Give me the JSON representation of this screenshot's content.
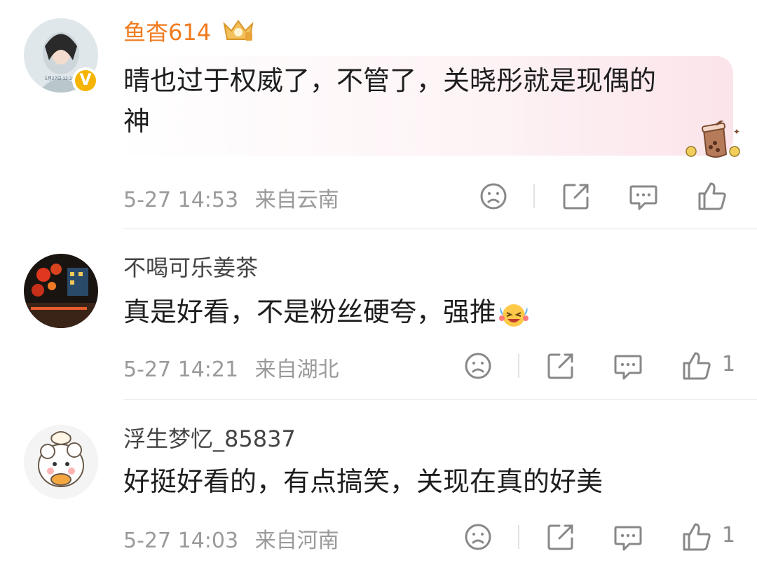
{
  "comments": [
    {
      "username": "鱼杳614",
      "text_line1": "晴也过于权威了，不管了，关晓彤就是现偶的",
      "text_line2": "神",
      "time": "5-27 14:53",
      "location": "来自云南",
      "like_count": "",
      "verified_badge": "V",
      "avatar_caption": "5月27日 12:29",
      "username_color": "#f07b1e"
    },
    {
      "username": "不喝可乐姜茶",
      "text": "真是好看，不是粉丝硬夸，强推",
      "time": "5-27 14:21",
      "location": "来自湖北",
      "like_count": "1"
    },
    {
      "username": "浮生梦忆_85837",
      "text": "好挺好看的，有点搞笑，关现在真的好美",
      "time": "5-27 14:03",
      "location": "来自河南",
      "like_count": "1"
    }
  ],
  "icons": [
    "sad-face-icon",
    "share-icon",
    "comment-icon",
    "like-icon",
    "crown-badge-icon",
    "bubble-tea-icon",
    "laugh-cry-emoji-icon"
  ]
}
